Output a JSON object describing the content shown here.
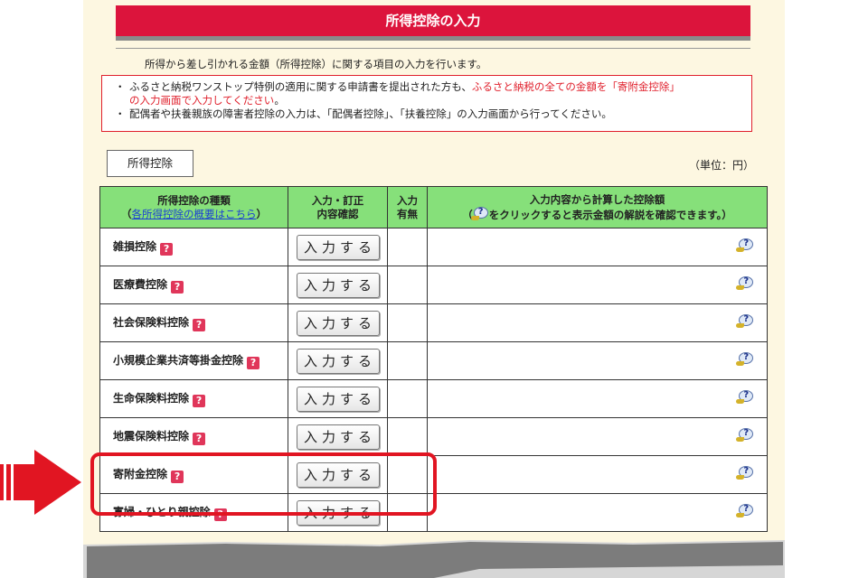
{
  "page": {
    "title": "所得控除の入力",
    "intro": "所得から差し引かれる金額（所得控除）に関する項目の入力を行います。"
  },
  "notice": {
    "bullet": "・",
    "line1_a": "ふるさと納税ワンストップ特例の適用に関する申請書を提出された方も、",
    "line1_b_red": "ふるさと納税の全ての金額を「寄附金控除」",
    "line1_c_red": "の入力画面で入力してください",
    "line1_d": "。",
    "line2": "配偶者や扶養親族の障害者控除の入力は、「配偶者控除」、「扶養控除」の入力画面から行ってください。"
  },
  "section": {
    "label": "所得控除",
    "unit": "（単位：円）"
  },
  "table": {
    "headers": {
      "type_title": "所得控除の種類",
      "type_link_open": "（",
      "type_link": "各所得控除の概要はこちら",
      "type_link_close": "）",
      "confirm_1": "入力・訂正",
      "confirm_2": "内容確認",
      "status_1": "入力",
      "status_2": "有無",
      "amount_1": "入力内容から計算した控除額",
      "amount_2a": "（",
      "amount_2b": "をクリックすると表示金額の解説を確認できます。）"
    },
    "button_label": "入力する",
    "help_glyph": "?",
    "rows": [
      {
        "name": "雑損控除"
      },
      {
        "name": "医療費控除"
      },
      {
        "name": "社会保険料控除"
      },
      {
        "name": "小規模企業共済等掛金控除"
      },
      {
        "name": "生命保険料控除"
      },
      {
        "name": "地震保険料控除"
      },
      {
        "name": "寄附金控除"
      },
      {
        "name": "寡婦・ひとり親控除"
      }
    ]
  },
  "annotation": {
    "highlight_color": "#e11522",
    "highlighted_row": "寄附金控除"
  },
  "colors": {
    "title_bar": "#dc143c",
    "header_green": "#86e07a",
    "page_background": "#fdf7e1",
    "notice_red": "#e0202c"
  },
  "icons": [
    "question-mark-icon",
    "help-balloon-icon",
    "pointer-arrow-icon"
  ]
}
